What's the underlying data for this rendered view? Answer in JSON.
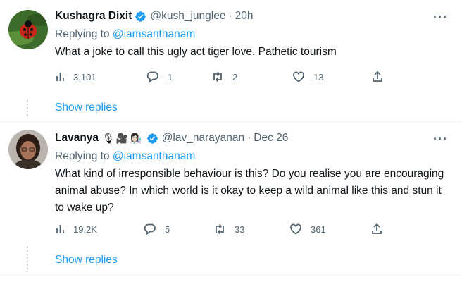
{
  "tweets": [
    {
      "name": "Kushagra Dixit",
      "handle": "@kush_junglee",
      "separator": "·",
      "time": "20h",
      "emoji": "",
      "replying_prefix": "Replying to ",
      "replying_handle": "@iamsanthanam",
      "text": "What a joke to call this ugly act tiger love. Pathetic tourism",
      "views": "3,101",
      "replies": "1",
      "retweets": "2",
      "likes": "13",
      "show_replies": "Show replies"
    },
    {
      "name": "Lavanya",
      "handle": "@lav_narayanan",
      "separator": "·",
      "time": "Dec 26",
      "emoji": "🎙🎥👩🏻‍🔬",
      "replying_prefix": "Replying to ",
      "replying_handle": "@iamsanthanam",
      "text": "What kind of irresponsible behaviour is this? Do you realise you are encouraging animal abuse? In which world is it okay to keep a wild animal like this and stun it to wake up?",
      "views": "19.2K",
      "replies": "5",
      "retweets": "33",
      "likes": "361",
      "show_replies": "Show replies"
    }
  ],
  "colors": {
    "accent": "#1d9bf0",
    "secondary_text": "#536471",
    "primary_text": "#0f1419",
    "divider": "#eff3f4"
  },
  "icons": [
    "verified-badge-icon",
    "more-icon",
    "views-icon",
    "reply-icon",
    "retweet-icon",
    "like-icon",
    "share-icon"
  ]
}
